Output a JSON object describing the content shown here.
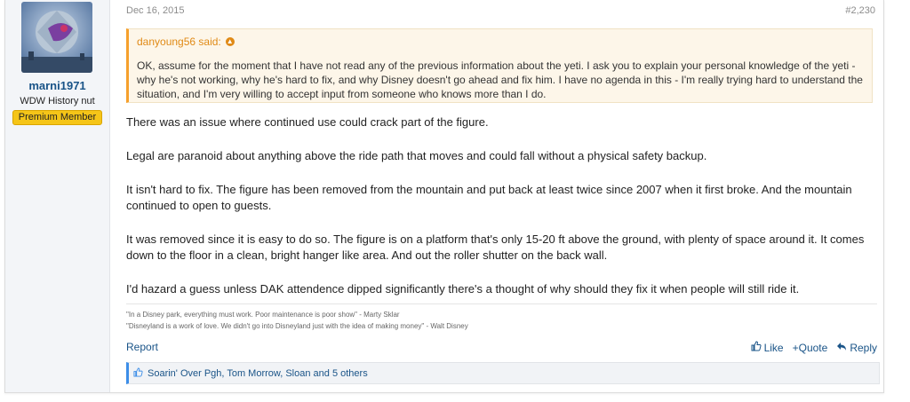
{
  "user": {
    "name": "marni1971",
    "title": "WDW History nut",
    "badge": "Premium Member"
  },
  "post": {
    "date": "Dec 16, 2015",
    "number": "#2,230",
    "quote": {
      "author": "danyoung56 said:",
      "text": "OK, assume for the moment that I have not read any of the previous information about the yeti. I ask you to explain your personal knowledge of the yeti - why he's not working, why he's hard to fix, and why Disney doesn't go ahead and fix him. I have no agenda in this - I'm really trying hard to understand the situation, and I'm very willing to accept input from someone who knows more than I do."
    },
    "paragraphs": [
      "There was an issue where continued use could crack part of the figure.",
      "Legal are paranoid about anything above the ride path that moves and could fall without a physical safety backup.",
      "It isn't hard to fix. The figure has been removed from the mountain and put back at least twice since 2007 when it first broke. And the mountain continued to open to guests.",
      "It was removed since it is easy to do so. The figure is on a platform that's only 15-20 ft above the ground, with plenty of space around it. It comes down to the floor in a clean, bright hanger like area. And out the roller shutter on the back wall.",
      "I'd hazard a guess unless DAK attendence dipped significantly there's a thought of why should they fix it when people will still ride it."
    ],
    "signature": [
      "\"In a Disney park, everything must work. Poor maintenance is poor show\" - Marty Sklar",
      "\"Disneyland is a work of love. We didn't go into Disneyland just with the idea of making money\" - Walt Disney"
    ]
  },
  "actions": {
    "report": "Report",
    "like": "Like",
    "quote": "+Quote",
    "reply": "Reply"
  },
  "likes": {
    "text": "Soarin' Over Pgh, Tom Morrow, Sloan and 5 others"
  },
  "colors": {
    "link": "#1a5488",
    "quote_accent": "#f6a02c",
    "badge": "#f5c518",
    "likes_accent": "#3d8ee8"
  }
}
